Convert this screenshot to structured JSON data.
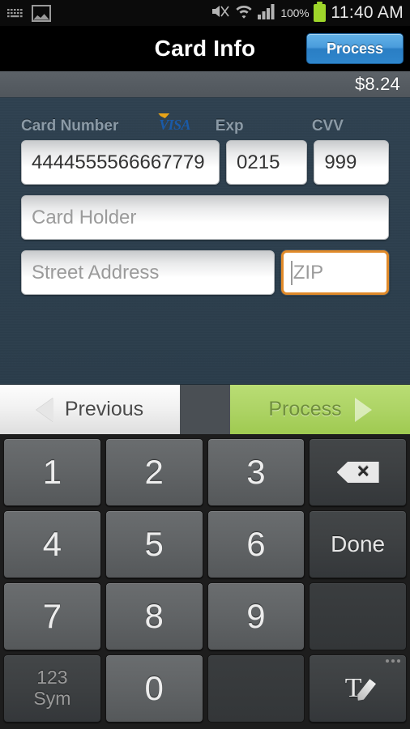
{
  "statusbar": {
    "icons_left": [
      "keyboard-icon",
      "picture-icon"
    ],
    "icons_right": [
      "mute-icon",
      "wifi-icon",
      "signal-icon"
    ],
    "battery_percent": "100%",
    "time": "11:40 AM"
  },
  "titlebar": {
    "title": "Card Info",
    "process_button": "Process"
  },
  "amountbar": {
    "amount": "$8.24"
  },
  "form": {
    "labels": {
      "card_number": "Card Number",
      "card_brand": "VISA",
      "exp": "Exp",
      "cvv": "CVV"
    },
    "fields": {
      "card_number_value": "4444555566667779",
      "exp_value": "0215",
      "cvv_value": "999",
      "card_holder_placeholder": "Card Holder",
      "street_placeholder": "Street Address",
      "zip_placeholder": "ZIP",
      "zip_value": ""
    },
    "focus_color": "#e08a2a"
  },
  "navbar": {
    "previous_label": "Previous",
    "process_label": "Process",
    "previous_icon": "triangle-left-icon",
    "process_icon": "triangle-right-icon",
    "process_color": "#aed466"
  },
  "keyboard": {
    "rows": [
      [
        {
          "label": "1",
          "type": "num",
          "name": "key-1"
        },
        {
          "label": "2",
          "type": "num",
          "name": "key-2"
        },
        {
          "label": "3",
          "type": "num",
          "name": "key-3"
        },
        {
          "label": "",
          "type": "backspace",
          "name": "key-backspace"
        }
      ],
      [
        {
          "label": "4",
          "type": "num",
          "name": "key-4"
        },
        {
          "label": "5",
          "type": "num",
          "name": "key-5"
        },
        {
          "label": "6",
          "type": "num",
          "name": "key-6"
        },
        {
          "label": "Done",
          "type": "fn",
          "name": "key-done"
        }
      ],
      [
        {
          "label": "7",
          "type": "num",
          "name": "key-7"
        },
        {
          "label": "8",
          "type": "num",
          "name": "key-8"
        },
        {
          "label": "9",
          "type": "num",
          "name": "key-9"
        },
        {
          "label": "",
          "type": "blank",
          "name": "key-blank-top"
        }
      ],
      [
        {
          "label": "123",
          "label2": "Sym",
          "type": "sym",
          "name": "key-sym"
        },
        {
          "label": "0",
          "type": "num",
          "name": "key-0"
        },
        {
          "label": "",
          "type": "blank",
          "name": "key-blank-bottom"
        },
        {
          "label": "",
          "type": "handwriting",
          "name": "key-handwriting"
        }
      ]
    ]
  }
}
